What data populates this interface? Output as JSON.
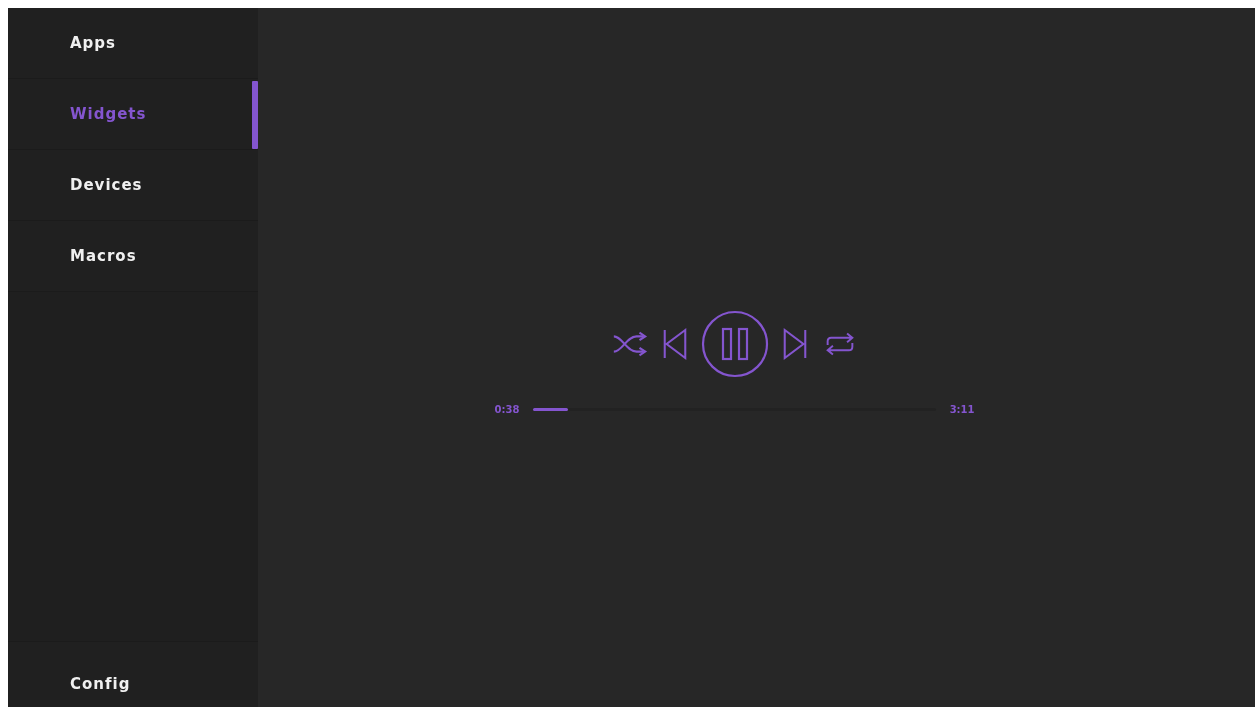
{
  "sidebar": {
    "items": [
      {
        "label": "Apps",
        "selected": false
      },
      {
        "label": "Widgets",
        "selected": true
      },
      {
        "label": "Devices",
        "selected": false
      },
      {
        "label": "Macros",
        "selected": false
      }
    ],
    "footer_item": {
      "label": "Config",
      "selected": false
    }
  },
  "player": {
    "playing": true,
    "elapsed": "0:38",
    "duration": "3:11",
    "level": 0.085
  }
}
